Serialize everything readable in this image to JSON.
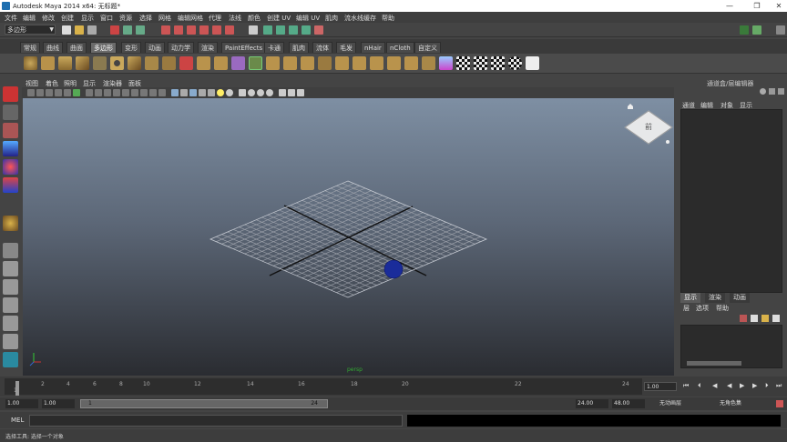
{
  "window": {
    "title": "Autodesk Maya 2014 x64: 无标题*",
    "minimize": "—",
    "maximize": "❐",
    "close": "✕"
  },
  "menubar": [
    "文件",
    "编辑",
    "修改",
    "创建",
    "显示",
    "窗口",
    "资源",
    "选择",
    "网格",
    "编辑网格",
    "代理",
    "法线",
    "颜色",
    "创建 UV",
    "编辑 UV",
    "肌肉",
    "流水线缓存",
    "帮助"
  ],
  "status_line": {
    "mode": "多边形"
  },
  "shelf_tabs": [
    "常规",
    "曲线",
    "曲面",
    "多边形",
    "变形",
    "动画",
    "动力学",
    "渲染",
    "PaintEffects",
    "卡通",
    "肌肉",
    "流体",
    "毛发",
    "nHair",
    "nCloth",
    "自定义"
  ],
  "shelf_active": "多边形",
  "panel_menu": [
    "视图",
    "着色",
    "照明",
    "显示",
    "渲染器",
    "面板"
  ],
  "viewport": {
    "axis_label": "persp",
    "view_cube_label": "前",
    "sphere_color": "#1a2c9a"
  },
  "right_panel": {
    "title": "通道盒/层编辑器",
    "tabs": [
      "通道",
      "编辑",
      "对象",
      "显示"
    ],
    "layer_tabs": [
      "显示",
      "渲染",
      "动画"
    ],
    "layer_menu": [
      "层",
      "选项",
      "帮助"
    ]
  },
  "timeline": {
    "ticks": [
      "2",
      "4",
      "6",
      "8",
      "10",
      "12",
      "14",
      "16",
      "18",
      "20",
      "22",
      "24"
    ],
    "current_frame_label": "1",
    "current_time": "1.00"
  },
  "range": {
    "start": "1.00",
    "start2": "1.00",
    "slider_start": "1",
    "slider_end": "24",
    "end": "24.00",
    "end2": "48.00",
    "anim_layer": "无动画层",
    "char_set": "无角色集"
  },
  "command_line": {
    "label": "MEL"
  },
  "help_line": {
    "text": "选择工具: 选择一个对象"
  }
}
